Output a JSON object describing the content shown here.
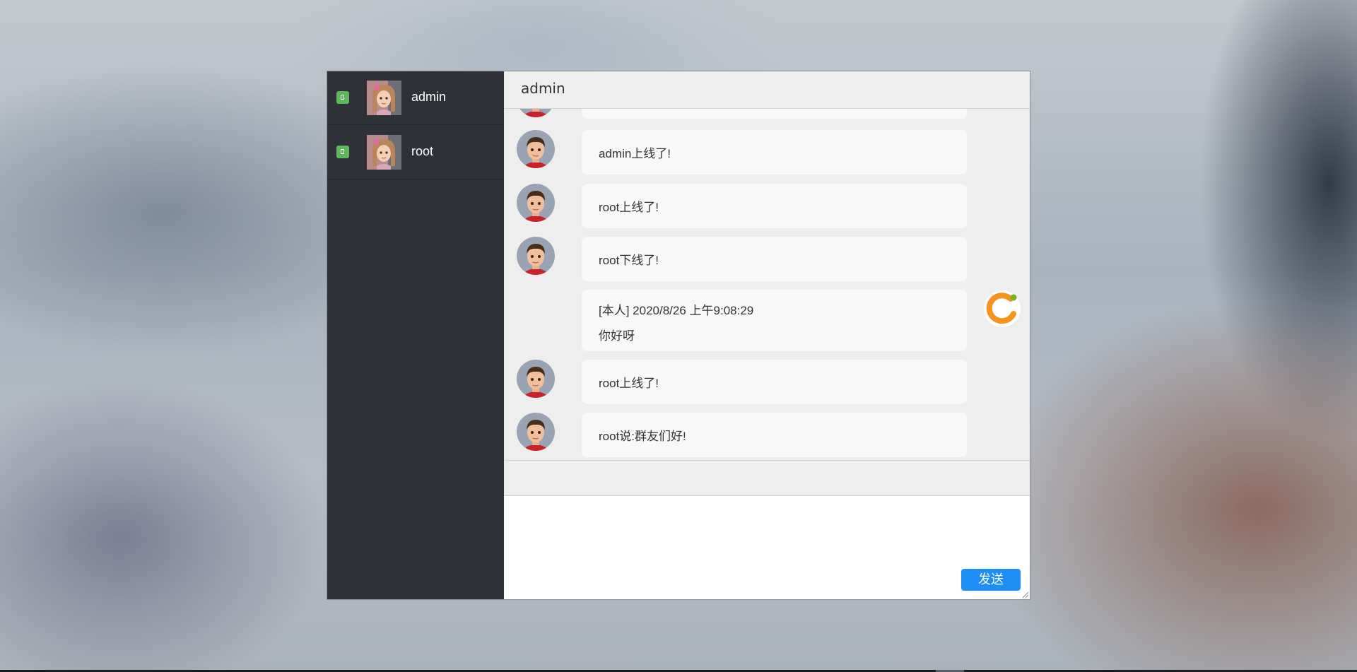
{
  "contacts": [
    {
      "name": "admin",
      "status_icon": "phone-icon",
      "avatar": "girl-avatar"
    },
    {
      "name": "root",
      "status_icon": "phone-icon",
      "avatar": "girl-avatar"
    }
  ],
  "chat": {
    "title": "admin",
    "messages": [
      {
        "text": "admin上线了!",
        "sender": "other"
      },
      {
        "text": "root上线了!",
        "sender": "other"
      },
      {
        "text": "root下线了!",
        "sender": "other"
      },
      {
        "meta": "[本人] 2020/8/26 上午9:08:29",
        "text": "你好呀",
        "sender": "self"
      },
      {
        "text": "root上线了!",
        "sender": "other"
      },
      {
        "text": "root说:群友们好!",
        "sender": "other"
      }
    ]
  },
  "composer": {
    "send_label": "发送"
  },
  "colors": {
    "sidebar": "#2e3138",
    "status": "#5cb85c",
    "send_button": "#1e8ef5",
    "self_avatar_orange": "#f7941d",
    "self_avatar_green": "#7ab317"
  }
}
